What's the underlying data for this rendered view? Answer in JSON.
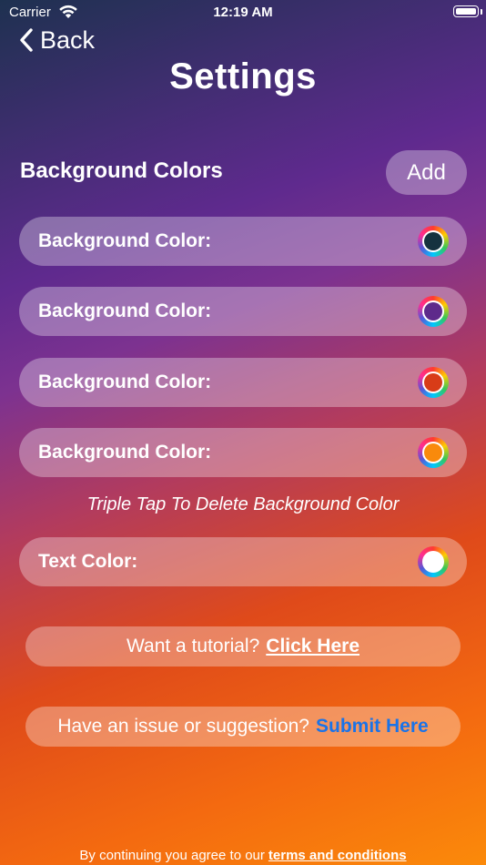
{
  "status_bar": {
    "carrier": "Carrier",
    "time": "12:19 AM"
  },
  "nav": {
    "back_label": "Back",
    "title": "Settings"
  },
  "background_section": {
    "title": "Background Colors",
    "add_label": "Add",
    "rows": [
      {
        "label": "Background Color:",
        "color": "#15323f"
      },
      {
        "label": "Background Color:",
        "color": "#5e2a8b"
      },
      {
        "label": "Background Color:",
        "color": "#d83c18"
      },
      {
        "label": "Background Color:",
        "color": "#f98a0c"
      }
    ],
    "hint": "Triple Tap To Delete Background Color"
  },
  "text_color": {
    "label": "Text Color:",
    "color": "#ffffff"
  },
  "tutorial": {
    "text": "Want a tutorial?",
    "link": "Click Here"
  },
  "feedback": {
    "text": "Have an issue or suggestion?",
    "link": "Submit Here",
    "link_color": "#1a73e8"
  },
  "footer": {
    "text": "By continuing you agree to our",
    "link": "terms and conditions"
  }
}
